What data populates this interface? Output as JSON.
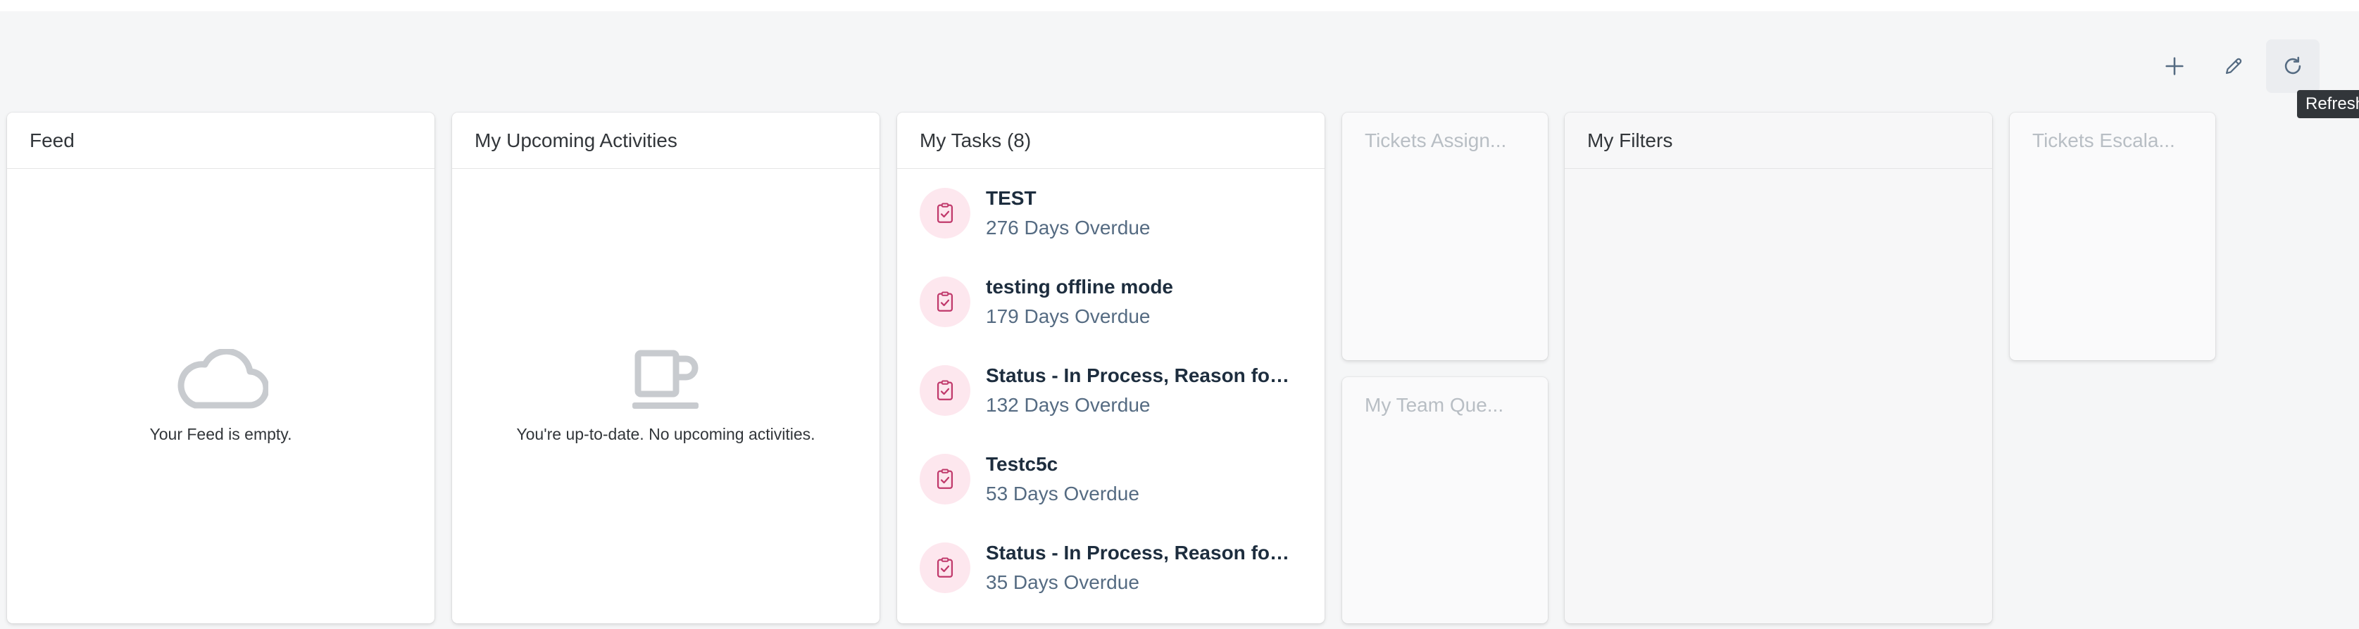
{
  "toolbar": {
    "add_icon": "plus-icon",
    "edit_icon": "pencil-icon",
    "refresh_icon": "refresh-icon",
    "tooltip": "Refresh"
  },
  "cards": {
    "feed": {
      "title": "Feed",
      "empty_text": "Your Feed is empty.",
      "icon": "cloud-icon"
    },
    "activities": {
      "title": "My Upcoming Activities",
      "empty_text": "You're up-to-date. No upcoming activities.",
      "icon": "coffee-cup-icon"
    },
    "tasks": {
      "title": "My Tasks (8)",
      "icon": "task-clipboard-icon",
      "items": [
        {
          "title": "TEST",
          "sub": "276 Days Overdue"
        },
        {
          "title": "testing offline mode",
          "sub": "179 Days Overdue"
        },
        {
          "title": "Status - In Process, Reason for ...",
          "sub": "132 Days Overdue"
        },
        {
          "title": "Testc5c",
          "sub": "53 Days Overdue"
        },
        {
          "title": "Status - In Process, Reason for ...",
          "sub": "35 Days Overdue"
        }
      ]
    },
    "tickets_assigned": {
      "title": "Tickets Assign..."
    },
    "team_queue": {
      "title": "My Team Que..."
    },
    "filters": {
      "title": "My Filters"
    },
    "tickets_escalated": {
      "title": "Tickets Escala..."
    }
  },
  "colors": {
    "accent_pink": "#c0396b",
    "icon_bg": "#fde7ee",
    "toolbar_icon": "#556b82"
  }
}
